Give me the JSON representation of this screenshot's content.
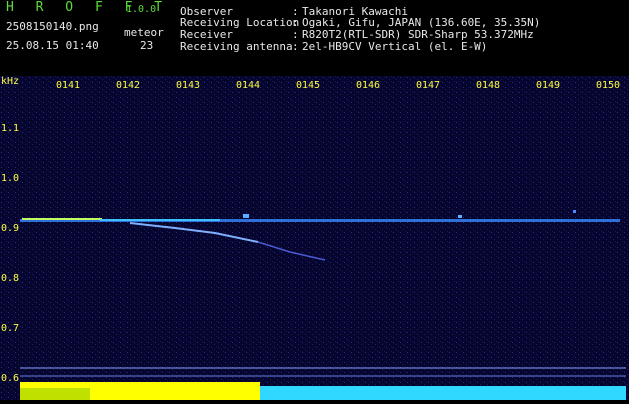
{
  "app": {
    "title": "H R O F F T",
    "version": "1.0.0"
  },
  "file": {
    "name": "2508150140.png",
    "datetime": "25.08.15 01:40"
  },
  "meteor": {
    "label": "meteor",
    "count": "23"
  },
  "info": [
    {
      "label": "Observer",
      "value": "Takanori Kawachi"
    },
    {
      "label": "Receiving Location",
      "value": "Ogaki, Gifu, JAPAN (136.60E, 35.35N)"
    },
    {
      "label": "Receiver",
      "value": "R820T2(RTL-SDR) SDR-Sharp 53.372MHz"
    },
    {
      "label": "Receiving antenna",
      "value": "2el-HB9CV Vertical (el. E-W)"
    }
  ],
  "info_separator": ":",
  "axis": {
    "freq_unit": "kHz",
    "freq_ticks": [
      "1.1",
      "1.0",
      "0.9",
      "0.8",
      "0.7",
      "0.6"
    ],
    "time_ticks": [
      "0141",
      "0142",
      "0143",
      "0144",
      "0145",
      "0146",
      "0147",
      "0148",
      "0149",
      "0150"
    ]
  },
  "colors": {
    "label_green": "#5ddc3a",
    "label_white": "#e8e8e8",
    "axis_yellow": "#ffff40",
    "background_blue": "#06063a",
    "carrier_cyan": "#40c0ff",
    "meteor_echo": "#7fb0ff",
    "level_yellow": "#ffff00",
    "level_cyan": "#40e0ff"
  }
}
